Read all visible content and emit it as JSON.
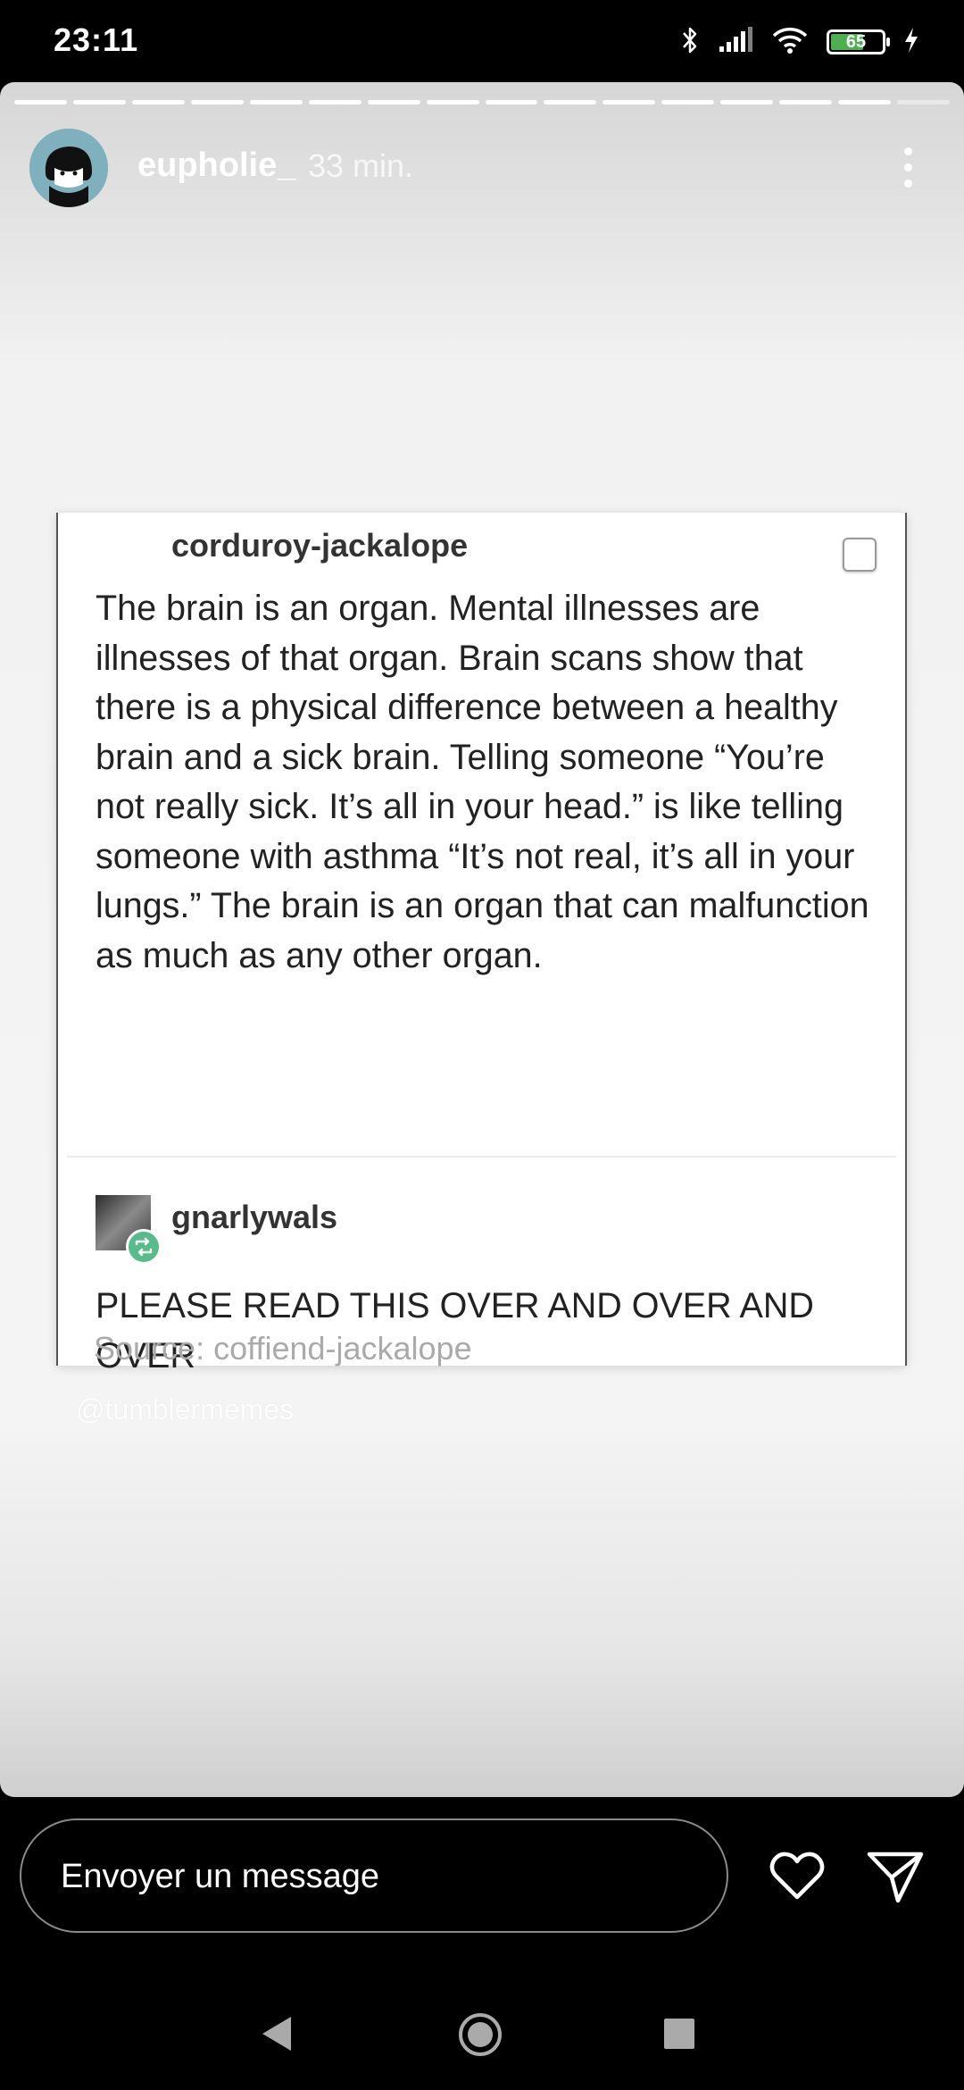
{
  "status_bar": {
    "time": "23:11",
    "battery_level": "65",
    "battery_fraction": 0.65
  },
  "story": {
    "progress_segments_total": 16,
    "progress_segments_viewed": 15,
    "username": "eupholie_",
    "time_ago": "33 min.",
    "more_icon": "more-vertical-icon"
  },
  "post": {
    "author": "corduroy-jackalope",
    "text": "The brain is an organ. Mental illnesses are illnesses of that organ. Brain scans show that there is a physical difference between a healthy brain and a sick brain. Telling someone “You’re not really sick. It’s all in your head.” is like telling someone with asthma “It’s not real, it’s all in your lungs.” The brain is an organ that can malfunction as much as any other organ.",
    "reblog_author": "gnarlywals",
    "reblog_text": "PLEASE READ THIS OVER AND OVER AND OVER",
    "source": "Source: coffiend-jackalope"
  },
  "watermark": "@tumblermemes",
  "composer": {
    "placeholder": "Envoyer un message",
    "like_icon": "heart-icon",
    "send_icon": "send-icon"
  },
  "nav": {
    "back_icon": "back-icon",
    "home_icon": "home-icon",
    "recents_icon": "recents-icon"
  },
  "colors": {
    "background": "#000000",
    "story_bg": "#f3f3f3",
    "reblog_badge": "#56bc8a",
    "battery": "#4caf50"
  }
}
